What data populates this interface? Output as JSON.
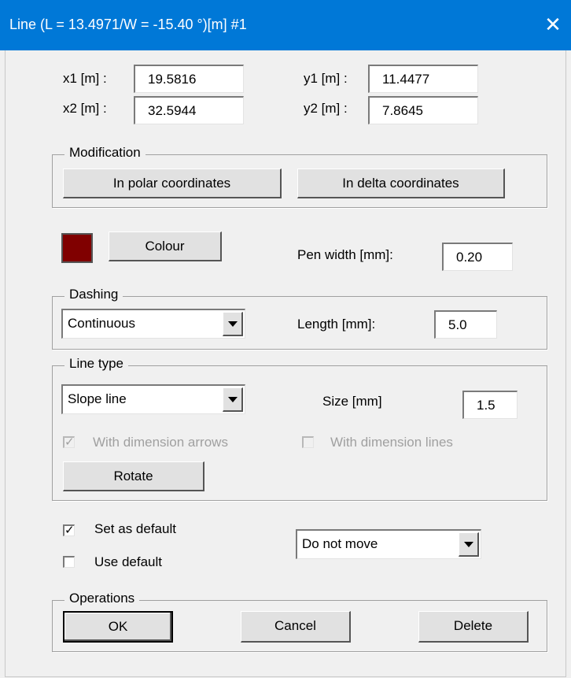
{
  "window": {
    "title": "Line (L = 13.4971/W = -15.40 °)[m]  #1",
    "close_glyph": "✕"
  },
  "coords": {
    "x1_label": "x1 [m] :",
    "x1_value": "19.5816",
    "y1_label": "y1 [m] :",
    "y1_value": "11.4477",
    "x2_label": "x2 [m] :",
    "x2_value": "32.5944",
    "y2_label": "y2 [m] :",
    "y2_value": "7.8645"
  },
  "modification": {
    "title": "Modification",
    "polar_button": "In polar coordinates",
    "delta_button": "In delta coordinates"
  },
  "pen": {
    "colour_button": "Colour",
    "colour_value": "#800000",
    "width_label": "Pen width [mm]:",
    "width_value": "0.20"
  },
  "dashing": {
    "title": "Dashing",
    "selected": "Continuous",
    "length_label": "Length [mm]:",
    "length_value": "5.0"
  },
  "line_type": {
    "title": "Line type",
    "selected": "Slope line",
    "size_label": "Size  [mm]",
    "size_value": "1.5",
    "arrows_label": "With dimension arrows",
    "arrows_checked": true,
    "lines_label": "With dimension lines",
    "lines_checked": false,
    "rotate_button": "Rotate"
  },
  "defaults": {
    "set_default_label": "Set as default",
    "set_default_checked": true,
    "use_default_label": "Use default",
    "use_default_checked": false,
    "move_selected": "Do not move"
  },
  "operations": {
    "title": "Operations",
    "ok_button": "OK",
    "cancel_button": "Cancel",
    "delete_button": "Delete"
  },
  "colors": {
    "titlebar": "#0078d7",
    "dialog_bg": "#f0f0f0"
  }
}
